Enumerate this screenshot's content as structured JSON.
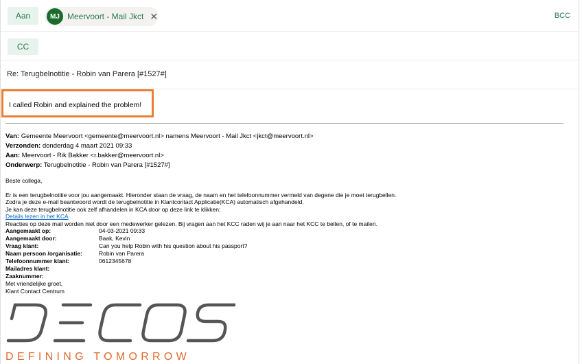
{
  "compose": {
    "to_label": "Aan",
    "cc_label": "CC",
    "bcc_label": "BCC",
    "recipient": {
      "initials": "MJ",
      "name": "Meervoort - Mail Jkct",
      "avatar_color": "#1a6b2c"
    },
    "subject": "Re: Terugbelnotitie - Robin van Parera [#1527#]",
    "reply_text": "I called Robin and explained the problem!"
  },
  "quoted": {
    "from_label": "Van:",
    "from_value": "Gemeente Meervoort <gemeente@meervoort.nl> namens Meervoort - Mail Jkct <jkct@meervoort.nl>",
    "sent_label": "Verzonden:",
    "sent_value": "donderdag 4 maart 2021 09:33",
    "to_label": "Aan:",
    "to_value": "Meervoort - Rik Bakker <r.bakker@meervoort.nl>",
    "subject_label": "Onderwerp:",
    "subject_value": "Terugbelnotitie - Robin van Parera [#1527#]",
    "greeting": "Beste collega,",
    "line1": "Er is een terugbelnotitie voor jou aangemaakt. Hieronder staan de vraag, de naam en het telefoonnummer vermeld van degene die je moet terugbellen.",
    "line2": "Zodra je deze e-mail beantwoord wordt de terugbelnotitie in Klantcontact Applicatie(KCA) automatisch afgehandeld.",
    "line3": "Je kan deze terugbelnotitie ook zelf afhandelen in KCA door op deze link te klikken:",
    "link_text": "Details lezen in het KCA",
    "line4": "Reacties op deze mail worden niet door een medewerker gelezen. Bij vragen aan het KCC raden wij je aan naar het KCC te bellen, of te mailen.",
    "fields": [
      {
        "key": "Aangemaakt op:",
        "value": "04-03-2021 09:33"
      },
      {
        "key": "Aangemaakt door:",
        "value": "Baak, Kevin"
      },
      {
        "key": "Vraag klant:",
        "value": "Can you help Robin with his question about his passport?"
      },
      {
        "key": "Naam persoon /organisatie:",
        "value": "Robin van Parera"
      },
      {
        "key": "Telefoonnummer klant:",
        "value": "0612345678"
      },
      {
        "key": "Mailadres klant:",
        "value": ""
      },
      {
        "key": "Zaaknummer:",
        "value": ""
      }
    ],
    "closing": "Met vriendelijke groet,",
    "signature": "Klant Contact Centrum"
  },
  "logo": {
    "name": "DECOS",
    "tagline": "DEFINING TOMORROW",
    "tagline_color": "#e06a2a"
  },
  "colors": {
    "accent_green": "#2b7a4b",
    "highlight_orange": "#ed7d31",
    "link_blue": "#0563c1"
  }
}
